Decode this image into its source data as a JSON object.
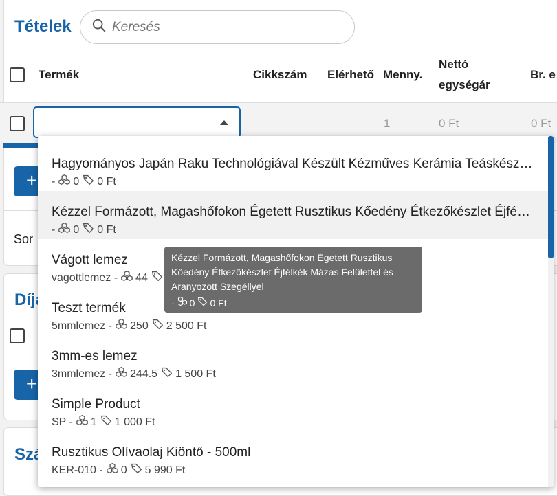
{
  "items_section": {
    "title": "Tételek",
    "search_placeholder": "Keresés",
    "columns": {
      "product": "Termék",
      "sku": "Cikkszám",
      "available": "Elérhető",
      "qty": "Menny.",
      "net_unit_line1": "Nettó",
      "net_unit_line2": "egységár",
      "gross_partial": "Br. e"
    },
    "edit_row": {
      "qty": "1",
      "net_price": "0 Ft",
      "gross_price": "0 Ft"
    },
    "add_button_icon": "+",
    "rows_label_partial": "Sor"
  },
  "fees_section": {
    "title_partial": "Díja",
    "add_button_icon": "+"
  },
  "invoice_section": {
    "title_partial": "Szá"
  },
  "dropdown": {
    "items": [
      {
        "name": "Hagyományos Japán Raku Technológiával Készült Kézműves Kerámia Teáskészlet",
        "sku": "-",
        "stock": "0",
        "price": "0 Ft"
      },
      {
        "name": "Kézzel Formázott, Magashőfokon Égetett Rusztikus Kőedény Étkezőkészlet Éjfélkék Mázas Felülettel és Aranyozott Szegéllyel",
        "sku": "-",
        "stock": "0",
        "price": "0 Ft"
      },
      {
        "name": "Vágott lemez",
        "sku": "vagottlemez -",
        "stock": "44",
        "price": ""
      },
      {
        "name": "Teszt termék",
        "sku": "5mmlemez -",
        "stock": "250",
        "price": "2 500 Ft"
      },
      {
        "name": "3mm-es lemez",
        "sku": "3mmlemez -",
        "stock": "244.5",
        "price": "1 500 Ft"
      },
      {
        "name": "Simple Product",
        "sku": "SP -",
        "stock": "1",
        "price": "1 000 Ft"
      },
      {
        "name": "Rusztikus Olívaolaj Kiöntő - 500ml",
        "sku": "KER-010 -",
        "stock": "0",
        "price": "5 990 Ft"
      }
    ],
    "icons": {
      "stock": "boxes-icon",
      "price": "price-tag-icon"
    }
  },
  "tooltip": {
    "line1": "Kézzel Formázott, Magashőfokon Égetett Rusztikus",
    "line2": "Kőedény Étkezőkészlet Éjfélkék Mázas Felülettel és",
    "line3": "Aranyozott Szegéllyel",
    "sku": "-",
    "stock": "0",
    "price": "0 Ft"
  },
  "colors": {
    "accent": "#1765a8",
    "tooltip_bg": "#6b6b6b"
  }
}
